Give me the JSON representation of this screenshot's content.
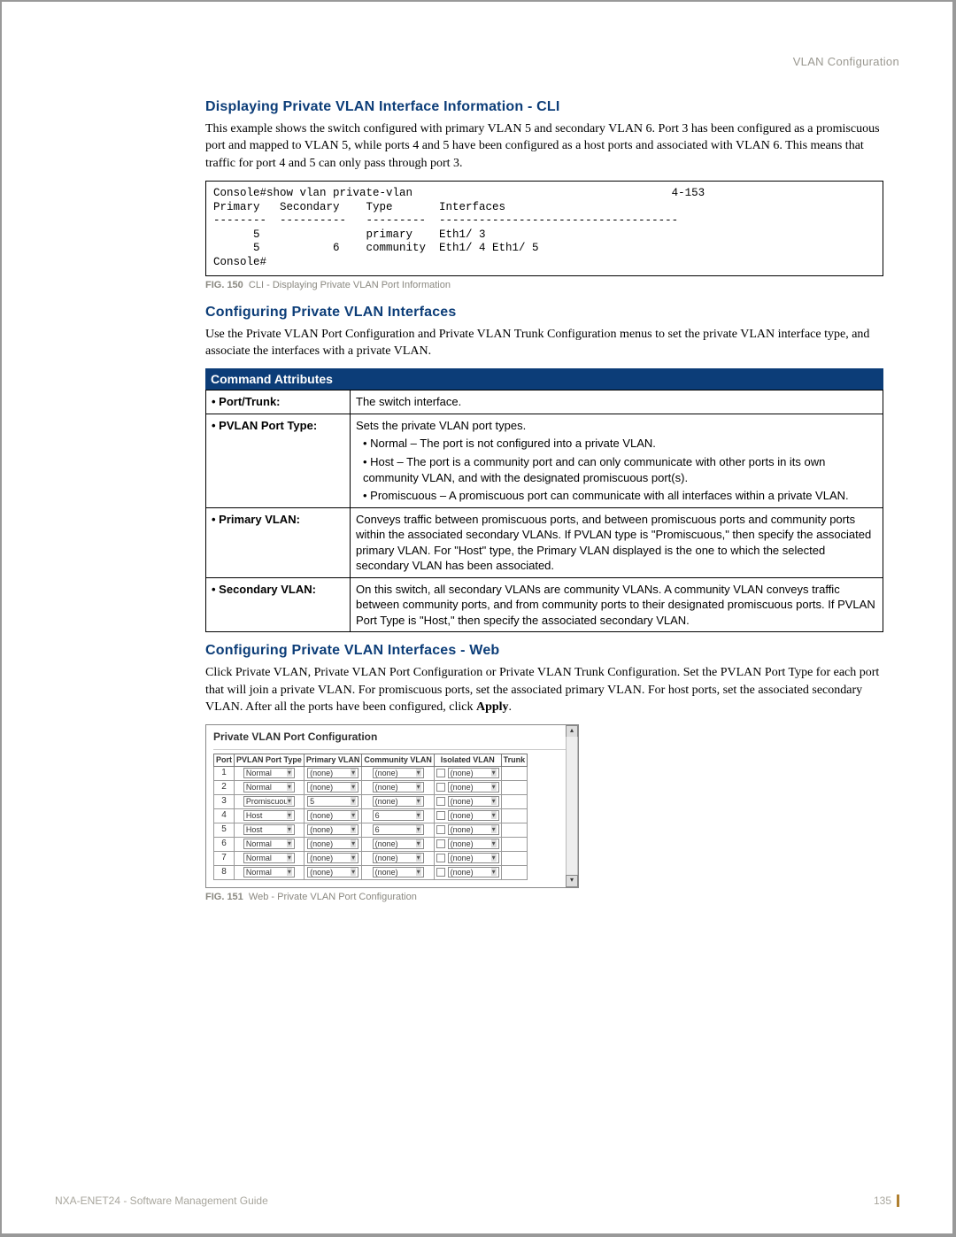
{
  "header": {
    "section": "VLAN Configuration"
  },
  "sec1": {
    "title": "Displaying Private VLAN Interface Information - CLI",
    "body": "This example shows the switch configured with primary VLAN 5 and secondary VLAN 6. Port 3 has been configured as a promiscuous port and mapped to VLAN 5, while ports 4 and 5 have been configured as a host ports and associated with VLAN 6. This means that traffic for port 4 and 5 can only pass through port 3."
  },
  "cli": "Console#show vlan private-vlan                                       4-153\nPrimary   Secondary    Type       Interfaces\n--------  ----------   ---------  ------------------------------------\n      5                primary    Eth1/ 3\n      5           6    community  Eth1/ 4 Eth1/ 5\nConsole#",
  "fig150": {
    "label": "FIG. 150",
    "text": "CLI - Displaying Private VLAN Port Information"
  },
  "sec2": {
    "title": "Configuring Private VLAN Interfaces",
    "body": "Use the Private VLAN Port Configuration and Private VLAN Trunk Configuration menus to set the private VLAN interface type, and associate the interfaces with a private VLAN."
  },
  "cmdHeader": "Command Attributes",
  "attrs": {
    "r1": {
      "label": "• Port/Trunk:",
      "text": "The switch interface."
    },
    "r2": {
      "label": "• PVLAN Port Type:",
      "intro": "Sets the private VLAN port types.",
      "b1": "• Normal – The port is not configured into a private VLAN.",
      "b2": "• Host – The port is a community port and can only communicate with other ports in its own community VLAN, and with the designated promiscuous port(s).",
      "b3": "• Promiscuous – A promiscuous port can communicate with all interfaces within a private VLAN."
    },
    "r3": {
      "label": "• Primary VLAN:",
      "text": "Conveys traffic between promiscuous ports, and between promiscuous ports and community ports within the associated secondary VLANs. If PVLAN type is \"Promiscuous,\" then specify the associated primary VLAN. For \"Host\" type, the Primary VLAN displayed is the one to which the selected secondary VLAN has been associated."
    },
    "r4": {
      "label": "• Secondary VLAN:",
      "text": "On this switch, all secondary VLANs are community VLANs. A community VLAN conveys traffic between community ports, and from community ports to their designated promiscuous ports. If PVLAN Port Type is \"Host,\" then specify the associated secondary VLAN."
    }
  },
  "sec3": {
    "title": "Configuring Private VLAN Interfaces - Web",
    "body1": "Click Private VLAN, Private VLAN Port Configuration or Private VLAN Trunk Configuration. Set the PVLAN Port Type for each port that will join a private VLAN. For promiscuous ports, set the associated primary VLAN. For host ports, set the associated secondary VLAN. After all the ports have been configured, click ",
    "apply": "Apply",
    "body2": "."
  },
  "shotTitle": "Private VLAN Port Configuration",
  "miniHeaders": [
    "Port",
    "PVLAN Port Type",
    "Primary VLAN",
    "Community VLAN",
    "Isolated VLAN",
    "Trunk"
  ],
  "rows": [
    {
      "port": "1",
      "type": "Normal",
      "primary": "(none)",
      "community": "(none)",
      "isolated": "(none)"
    },
    {
      "port": "2",
      "type": "Normal",
      "primary": "(none)",
      "community": "(none)",
      "isolated": "(none)"
    },
    {
      "port": "3",
      "type": "Promiscuous",
      "primary": "5",
      "community": "(none)",
      "isolated": "(none)"
    },
    {
      "port": "4",
      "type": "Host",
      "primary": "(none)",
      "community": "6",
      "isolated": "(none)"
    },
    {
      "port": "5",
      "type": "Host",
      "primary": "(none)",
      "community": "6",
      "isolated": "(none)"
    },
    {
      "port": "6",
      "type": "Normal",
      "primary": "(none)",
      "community": "(none)",
      "isolated": "(none)"
    },
    {
      "port": "7",
      "type": "Normal",
      "primary": "(none)",
      "community": "(none)",
      "isolated": "(none)"
    },
    {
      "port": "8",
      "type": "Normal",
      "primary": "(none)",
      "community": "(none)",
      "isolated": "(none)"
    }
  ],
  "fig151": {
    "label": "FIG. 151",
    "text": "Web - Private VLAN Port Configuration"
  },
  "footer": {
    "doc": "NXA-ENET24 - Software Management Guide",
    "page": "135"
  }
}
